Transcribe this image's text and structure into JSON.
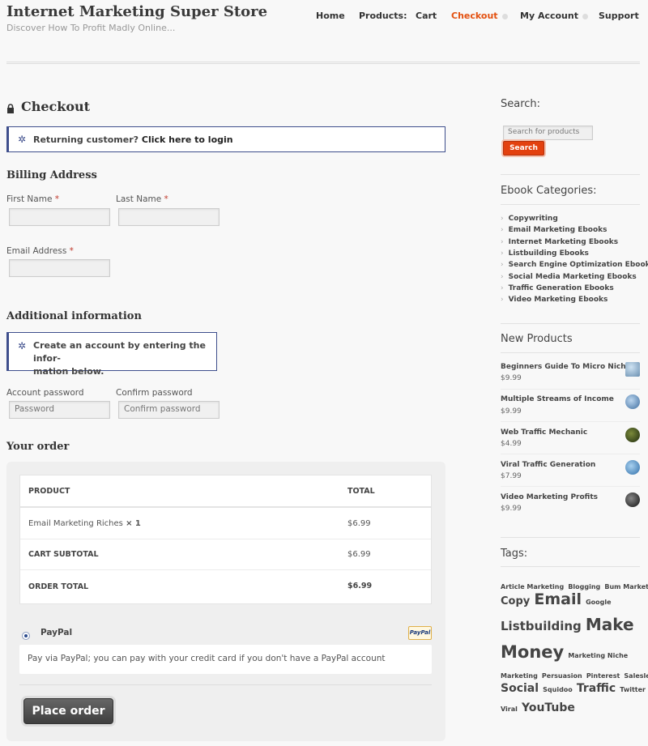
{
  "header": {
    "site_title": "Internet Marketing Super Store",
    "tagline": "Discover How To Profit Madly Online...",
    "nav": [
      {
        "label": "Home"
      },
      {
        "label": "Products:"
      },
      {
        "label": "Cart"
      },
      {
        "label": "Checkout"
      },
      {
        "label": "My Account"
      },
      {
        "label": "Support"
      }
    ],
    "accent_color": "#e3500f"
  },
  "checkout": {
    "title": "Checkout",
    "login_notice_prefix": "Returning customer?",
    "login_notice_link": "Click here to login",
    "billing_heading": "Billing Address",
    "first_name_label": "First Name",
    "last_name_label": "Last Name",
    "email_label": "Email Address",
    "required_mark": "*",
    "additional_heading": "Additional information",
    "account_notice_line1": "Create an account by entering the infor-",
    "account_notice_line2": "mation below.",
    "account_password_label": "Account password",
    "account_password_placeholder": "Password",
    "confirm_password_label": "Confirm password",
    "confirm_password_placeholder": "Confirm password"
  },
  "order": {
    "heading": "Your order",
    "col_product": "PRODUCT",
    "col_total": "TOTAL",
    "item_name": "Email Marketing Riches",
    "item_qty": "× 1",
    "item_total": "$6.99",
    "subtotal_label": "CART SUBTOTAL",
    "subtotal_value": "$6.99",
    "total_label": "ORDER TOTAL",
    "total_value": "$6.99",
    "payment_method": "PayPal",
    "paypal_badge": "PayPal",
    "payment_description": "Pay via PayPal; you can pay with your credit card if you don't have a PayPal account",
    "place_order": "Place order"
  },
  "sidebar": {
    "search_heading": "Search:",
    "search_placeholder": "Search for products",
    "search_button": "Search",
    "categories_heading": "Ebook Categories:",
    "categories": [
      "Copywriting",
      "Email Marketing Ebooks",
      "Internet Marketing Ebooks",
      "Listbuilding Ebooks",
      "Search Engine Optimization Ebooks",
      "Social Media Marketing Ebooks",
      "Traffic Generation Ebooks",
      "Video Marketing Ebooks"
    ],
    "new_products_heading": "New Products",
    "new_products": [
      {
        "name": "Beginners Guide To Micro Niches",
        "price": "$9.99"
      },
      {
        "name": "Multiple Streams of Income",
        "price": "$9.99"
      },
      {
        "name": "Web Traffic Mechanic",
        "price": "$4.99"
      },
      {
        "name": "Viral Traffic Generation",
        "price": "$7.99"
      },
      {
        "name": "Video Marketing Profits",
        "price": "$9.99"
      }
    ],
    "tags_heading": "Tags:",
    "tags": [
      "Article Marketing",
      "Blogging",
      "Bum Marketing",
      "Copy",
      "Email",
      "Google",
      "Listbuilding",
      "Make",
      "Money",
      "Marketing Niche",
      "Marketing",
      "Persuasion",
      "Pinterest",
      "Salesletters",
      "Social",
      "Squidoo",
      "Traffic",
      "Twitter",
      "Viral",
      "YouTube"
    ]
  }
}
